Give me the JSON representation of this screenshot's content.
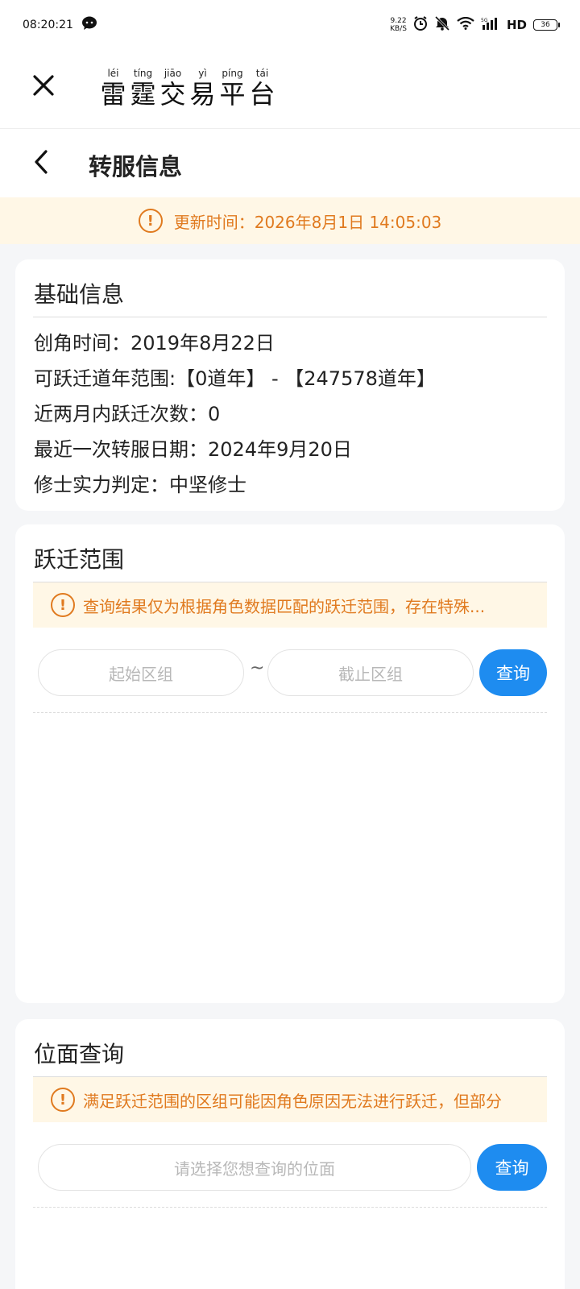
{
  "status_bar": {
    "time": "08:20:21",
    "speed_value": "9.22",
    "speed_unit": "KB/S",
    "hd_label": "HD",
    "battery": "36"
  },
  "header": {
    "title_chars": [
      {
        "pinyin": "léi",
        "char": "雷"
      },
      {
        "pinyin": "tíng",
        "char": "霆"
      },
      {
        "pinyin": "jiāo",
        "char": "交"
      },
      {
        "pinyin": "yì",
        "char": "易"
      },
      {
        "pinyin": "píng",
        "char": "平"
      },
      {
        "pinyin": "tái",
        "char": "台"
      }
    ]
  },
  "subnav": {
    "title": "转服信息"
  },
  "update_banner": {
    "text": "更新时间：2026年8月1日 14:05:03"
  },
  "basic_info": {
    "title": "基础信息",
    "lines": [
      "创角时间：2019年8月22日",
      "可跃迁道年范围:【0道年】 - 【247578道年】",
      "近两月内跃迁次数：0",
      "最近一次转服日期：2024年9月20日",
      "修士实力判定：中坚修士"
    ]
  },
  "jump_range": {
    "title": "跃迁范围",
    "notice": "查询结果仅为根据角色数据匹配的跃迁范围，存在特殊...",
    "start_placeholder": "起始区组",
    "separator": "~",
    "end_placeholder": "截止区组",
    "query_label": "查询"
  },
  "position_query": {
    "title": "位面查询",
    "notice": "满足跃迁范围的区组可能因角色原因无法进行跃迁，但部分",
    "placeholder": "请选择您想查询的位面",
    "query_label": "查询"
  },
  "colors": {
    "accent": "#1e8cf0",
    "warning": "#e07a1f",
    "warning_bg": "#fff7e6"
  }
}
